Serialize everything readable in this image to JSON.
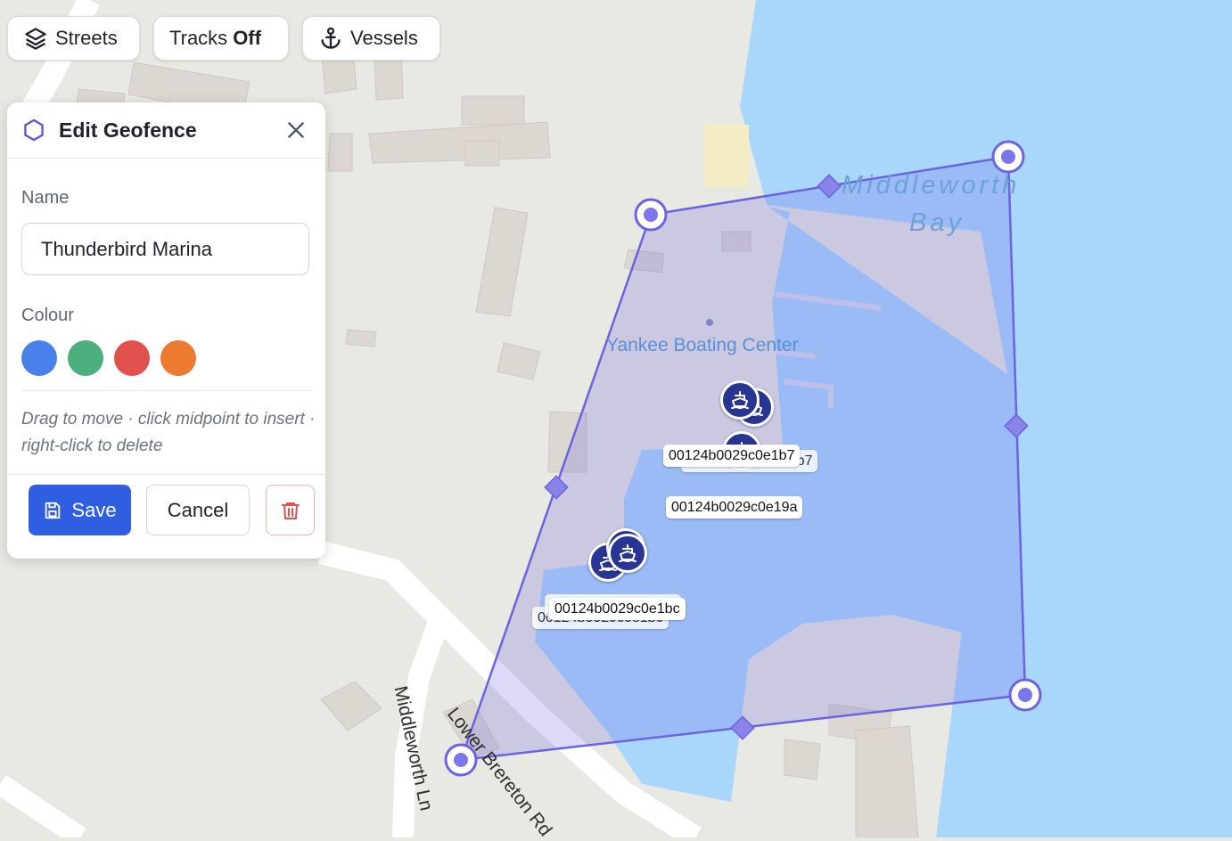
{
  "toolbar": {
    "streets_label": "Streets",
    "tracks_label": "Tracks",
    "tracks_state": "Off",
    "vessels_label": "Vessels"
  },
  "panel": {
    "title": "Edit Geofence",
    "name_label": "Name",
    "name_value": "Thunderbird Marina",
    "colour_label": "Colour",
    "colours": [
      "#4a80ea",
      "#4caf7d",
      "#e0504d",
      "#ec7a30"
    ],
    "hint": "Drag to move · click midpoint to insert · right-click to delete",
    "save_label": "Save",
    "cancel_label": "Cancel"
  },
  "map": {
    "water_label_1": "Middleworth",
    "water_label_2": "Bay",
    "poi_label": "Yankee Boating Center",
    "road_1": "Lower Brereton Rd",
    "road_2": "Middleworth Ln",
    "geofence_color": "#6b63e0",
    "vessels": [
      {
        "id": "00124b0029c0e1b7"
      },
      {
        "id": "00124b0029c0e19a"
      },
      {
        "id": "00124b0029c0e1bc"
      }
    ]
  }
}
